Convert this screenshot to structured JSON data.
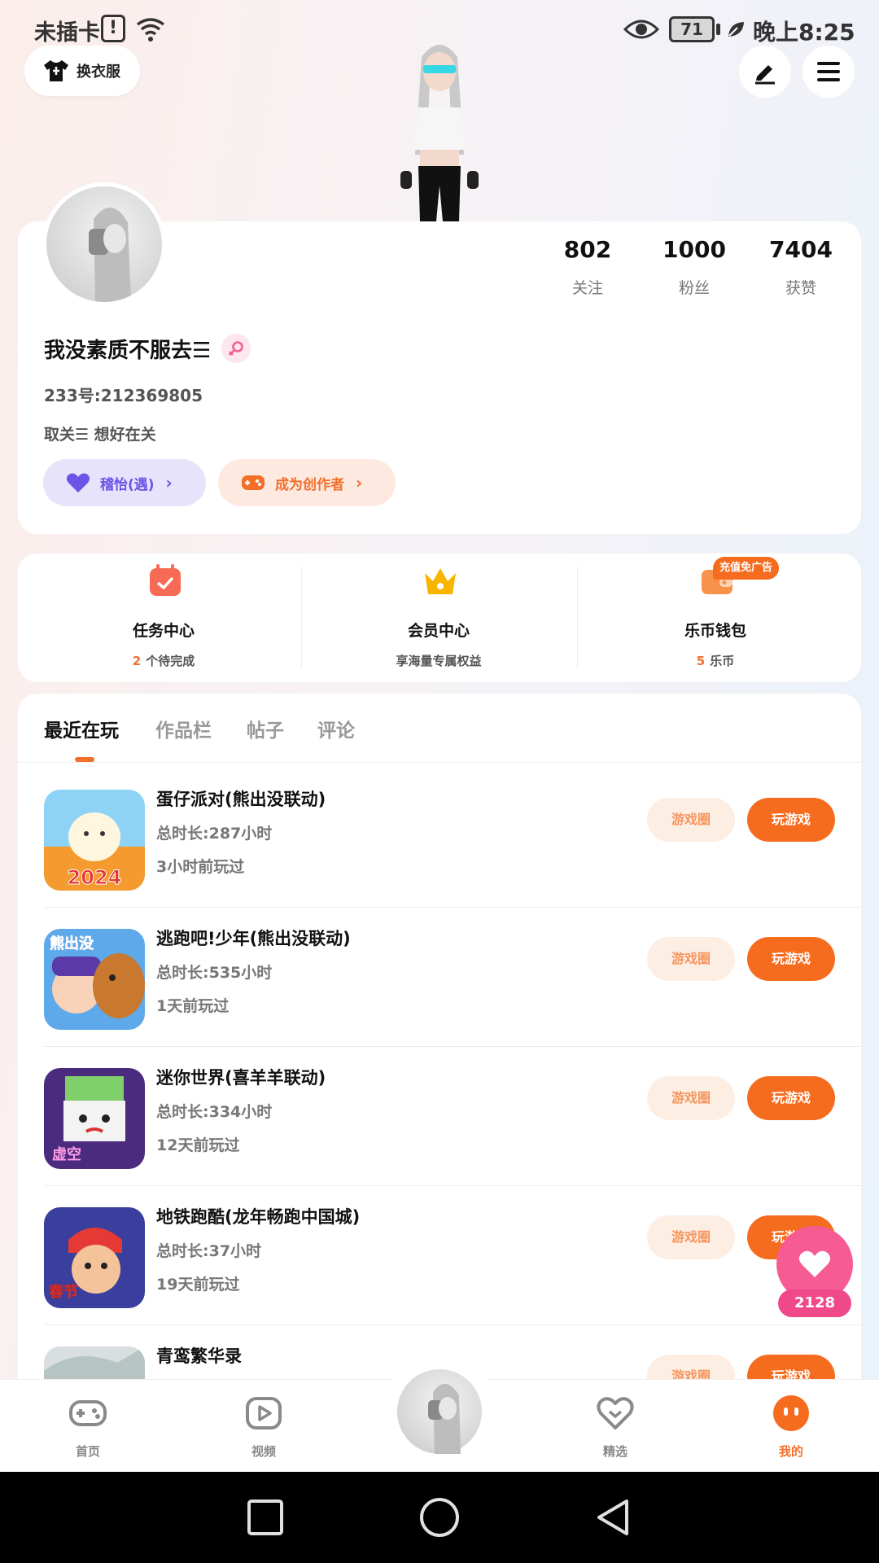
{
  "status_bar": {
    "carrier": "未插卡",
    "sim_alert": "!",
    "battery": "71",
    "time": "晚上8:25"
  },
  "top_actions": {
    "outfit_label": "换衣服"
  },
  "profile": {
    "stats": [
      {
        "value": "802",
        "label": "关注"
      },
      {
        "value": "1000",
        "label": "粉丝"
      },
      {
        "value": "7404",
        "label": "获赞"
      }
    ],
    "username": "我没素质不服去☰",
    "uid": "233号:212369805",
    "bio": "取关☰ 想好在关",
    "status_pill": "稽怡(遇)",
    "creator_pill": "成为创作者"
  },
  "services": {
    "task": {
      "title": "任务中心",
      "count": "2",
      "sub": "个待完成"
    },
    "vip": {
      "title": "会员中心",
      "sub": "享海量专属权益"
    },
    "wallet": {
      "title": "乐币钱包",
      "count": "5",
      "sub": "乐币",
      "badge": "充值免广告"
    }
  },
  "tabs": [
    "最近在玩",
    "作品栏",
    "帖子",
    "评论"
  ],
  "games": [
    {
      "name": "蛋仔派对(熊出没联动)",
      "duration": "总时长:287小时",
      "last": "3小时前玩过",
      "icon_text": "2024",
      "circle_label": "游戏圈",
      "play_label": "玩游戏"
    },
    {
      "name": "逃跑吧!少年(熊出没联动)",
      "duration": "总时长:535小时",
      "last": "1天前玩过",
      "icon_text": "熊出没",
      "circle_label": "游戏圈",
      "play_label": "玩游戏"
    },
    {
      "name": "迷你世界(喜羊羊联动)",
      "duration": "总时长:334小时",
      "last": "12天前玩过",
      "icon_text": "虚空",
      "circle_label": "游戏圈",
      "play_label": "玩游戏"
    },
    {
      "name": "地铁跑酷(龙年畅跑中国城)",
      "duration": "总时长:37小时",
      "last": "19天前玩过",
      "icon_text": "春节",
      "circle_label": "游戏圈",
      "play_label": "玩游戏"
    },
    {
      "name": "青鸾繁华录",
      "duration": "",
      "last": "",
      "icon_text": "",
      "circle_label": "游戏圈",
      "play_label": "玩游戏"
    }
  ],
  "like_fab": {
    "count": "2128"
  },
  "bottom_nav": [
    "首页",
    "视频",
    "精选",
    "我的"
  ],
  "colors": {
    "accent": "#f66c1f",
    "purple": "#6b55e6",
    "pink": "#f65b93"
  }
}
